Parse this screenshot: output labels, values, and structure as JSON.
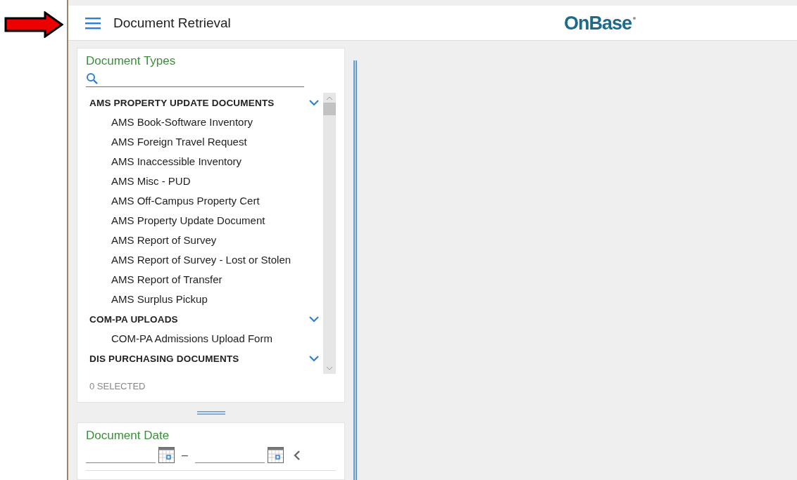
{
  "header": {
    "title": "Document Retrieval",
    "logo": "OnBase"
  },
  "document_types": {
    "title": "Document Types",
    "groups": [
      {
        "label": "AMS PROPERTY UPDATE DOCUMENTS",
        "expanded": true,
        "children": [
          "AMS Book-Software Inventory",
          "AMS Foreign Travel Request",
          "AMS Inaccessible Inventory",
          "AMS Misc - PUD",
          "AMS Off-Campus Property Cert",
          "AMS Property Update Document",
          "AMS Report of Survey",
          "AMS Report of Survey - Lost or Stolen",
          "AMS Report of Transfer",
          "AMS Surplus Pickup"
        ]
      },
      {
        "label": "COM-PA UPLOADS",
        "expanded": true,
        "children": [
          "COM-PA Admissions Upload Form"
        ]
      },
      {
        "label": "DIS PURCHASING DOCUMENTS",
        "expanded": true
      }
    ],
    "selected_count": "0 SELECTED"
  },
  "document_date": {
    "title": "Document Date",
    "separator": "–"
  }
}
